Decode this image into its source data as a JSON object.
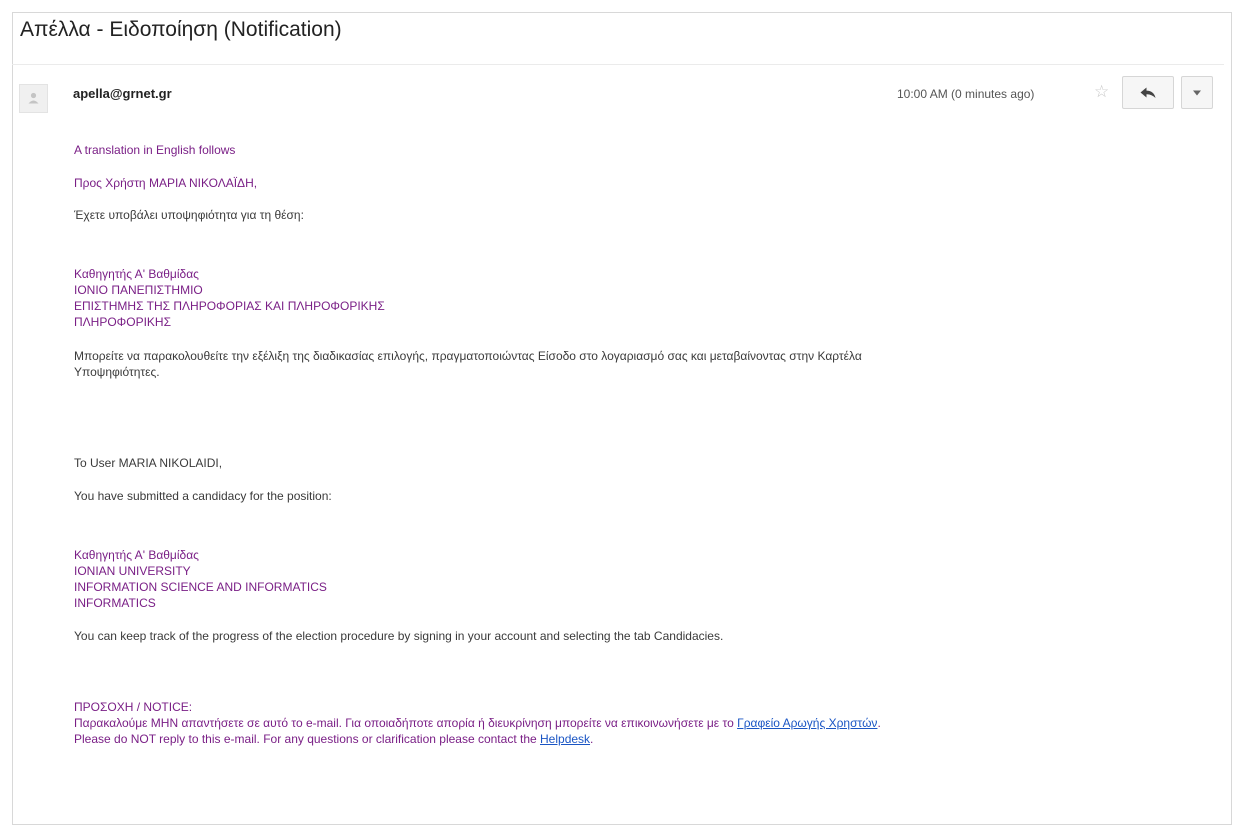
{
  "email": {
    "subject": "Απέλλα - Ειδοποίηση (Notification)",
    "sender": "apella@grnet.gr",
    "time": "10:00 AM (0 minutes ago)",
    "icons": {
      "avatar": "person-icon",
      "star": "star-icon",
      "reply": "reply-icon",
      "more": "chevron-down-icon"
    }
  },
  "body": {
    "translation_note": "A translation in English follows",
    "gr": {
      "greeting": "Προς Χρήστη ΜΑΡΙΑ ΝΙΚΟΛΑΪΔΗ,",
      "submitted": "Έχετε υποβάλει υποψηφιότητα για τη θέση:",
      "position": [
        "Καθηγητής Α' Βαθμίδας",
        "ΙΟΝΙΟ ΠΑΝΕΠΙΣΤΗΜΙΟ",
        "ΕΠΙΣΤΗΜΗΣ ΤΗΣ ΠΛΗΡΟΦΟΡΙΑΣ ΚΑΙ ΠΛΗΡΟΦΟΡΙΚΗΣ",
        "ΠΛΗΡΟΦΟΡΙΚΗΣ"
      ],
      "track_line1": "Μπορείτε να παρακολουθείτε την εξέλιξη της διαδικασίας επιλογής, πραγματοποιώντας Είσοδο στο λογαριασμό σας και μεταβαίνοντας στην Καρτέλα",
      "track_line2": "Υποψηφιότητες."
    },
    "en": {
      "greeting": "To User MARIA NIKOLAIDI,",
      "submitted": "You have submitted a candidacy for the position:",
      "position": [
        "Καθηγητής Α' Βαθμίδας",
        "IONIAN UNIVERSITY",
        "INFORMATION SCIENCE AND INFORMATICS",
        "INFORMATICS"
      ],
      "track": "You can keep track of the progress of the election procedure by signing in your account and selecting the tab Candidacies."
    },
    "notice": {
      "title": "ΠΡΟΣΟΧΗ / NOTICE:",
      "gr_text": "Παρακαλούμε ΜΗΝ απαντήσετε σε αυτό το e-mail. Για οποιαδήποτε απορία ή διευκρίνηση μπορείτε να επικοινωνήσετε με το ",
      "gr_link": "Γραφείο Αρωγής Χρηστών",
      "gr_end": ".",
      "en_text": "Please do NOT reply to this e-mail. For any questions or clarification please contact the ",
      "en_link": "Helpdesk",
      "en_end": "."
    }
  }
}
